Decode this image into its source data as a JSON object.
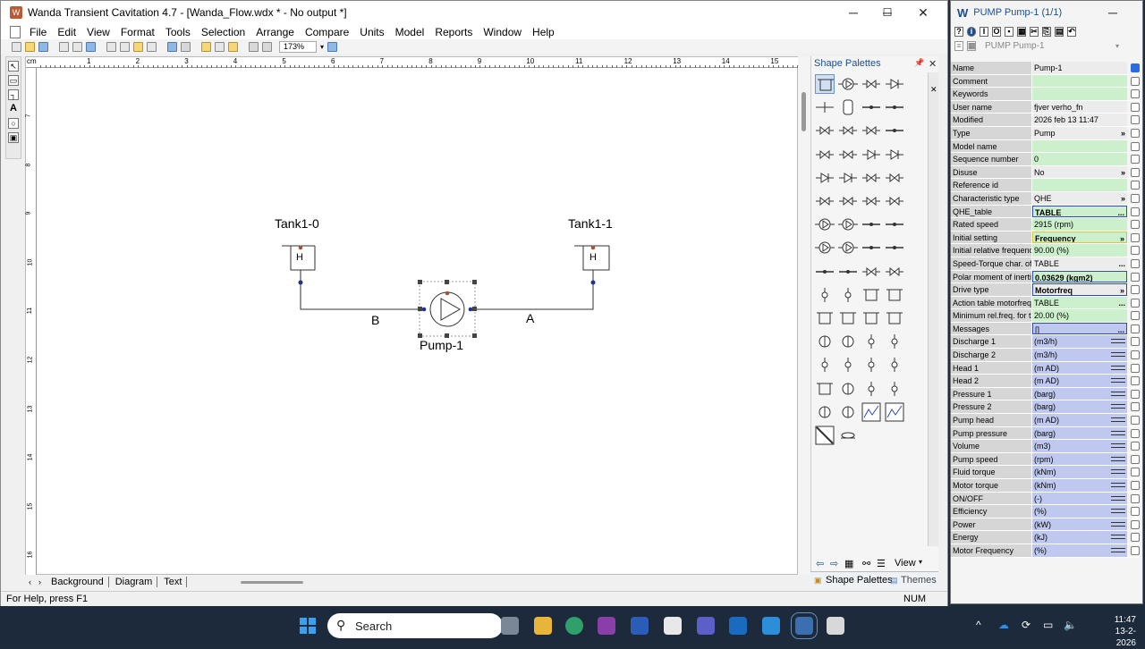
{
  "window": {
    "title": "Wanda Transient Cavitation 4.7 - [Wanda_Flow.wdx * - No output *]",
    "min": "─",
    "max": "☐",
    "close": "✕"
  },
  "menu": [
    "File",
    "Edit",
    "View",
    "Format",
    "Tools",
    "Selection",
    "Arrange",
    "Compare",
    "Units",
    "Model",
    "Reports",
    "Window",
    "Help"
  ],
  "toolbar": {
    "zoom": "173%"
  },
  "ruler": {
    "unit": "cm",
    "h_ticks": [
      "1",
      "2",
      "3",
      "4",
      "5",
      "6",
      "7",
      "8",
      "9",
      "10",
      "11",
      "12",
      "13",
      "14",
      "15"
    ],
    "v_ticks": [
      "7",
      "8",
      "9",
      "10",
      "11",
      "12",
      "13",
      "14",
      "15",
      "16"
    ]
  },
  "diagram": {
    "tank_left": "Tank1-0",
    "tank_right": "Tank1-1",
    "tank_symbol": "H",
    "pump": "Pump-1",
    "pipe_left": "B",
    "pipe_right": "A"
  },
  "tabs": [
    "Background",
    "Diagram",
    "Text"
  ],
  "status": {
    "help": "For Help, press F1",
    "num": "NUM"
  },
  "palette": {
    "title": "Shape Palettes",
    "view": "View",
    "tab_shapes": "Shape Palettes",
    "tab_themes": "Themes"
  },
  "props": {
    "title": "PUMP Pump-1 (1/1)",
    "object": "PUMP Pump-1",
    "rows": [
      {
        "name": "Name",
        "value": "Pump-1",
        "style": "w",
        "check": true
      },
      {
        "name": "Comment",
        "value": "",
        "style": "g"
      },
      {
        "name": "Keywords",
        "value": "",
        "style": "g"
      },
      {
        "name": "User name",
        "value": "fjver verho_fn",
        "style": "w"
      },
      {
        "name": "Modified",
        "value": "2026 feb 13  11:47",
        "style": "w"
      },
      {
        "name": "Type",
        "value": "Pump",
        "style": "w",
        "btn": "»"
      },
      {
        "name": "Model name",
        "value": "",
        "style": "g"
      },
      {
        "name": "Sequence number",
        "value": "0",
        "style": "g"
      },
      {
        "name": "Disuse",
        "value": "No",
        "style": "w",
        "btn": "»"
      },
      {
        "name": "Reference id",
        "value": "",
        "style": "g"
      },
      {
        "name": "Characteristic type",
        "value": "QHE",
        "style": "w",
        "btn": "»"
      },
      {
        "name": "QHE_table",
        "value": "TABLE",
        "style": "g",
        "bold": true,
        "sel": true,
        "btn": "..."
      },
      {
        "name": "Rated speed",
        "value": "2915 (rpm)",
        "style": "g"
      },
      {
        "name": "Initial setting",
        "value": "Frequency",
        "style": "g",
        "bold": true,
        "yel": true,
        "btn": "»"
      },
      {
        "name": "Initial relative frequency",
        "value": "90.00 (%)",
        "style": "g"
      },
      {
        "name": "Speed-Torque char. of motor",
        "value": "TABLE",
        "style": "w",
        "btn": "..."
      },
      {
        "name": "Polar moment of inertia",
        "value": "0.03629 (kgm2)",
        "style": "g",
        "bold": true,
        "sel": true
      },
      {
        "name": "Drive type",
        "value": "Motorfreq",
        "style": "w",
        "bold": true,
        "sel": true,
        "btn": "»"
      },
      {
        "name": "Action table motorfreq.",
        "value": "TABLE",
        "style": "g",
        "btn": "..."
      },
      {
        "name": "Minimum rel.freq. for trip",
        "value": "20.00 (%)",
        "style": "g"
      },
      {
        "name": "Messages",
        "value": "[]",
        "style": "b",
        "sel": true,
        "btn": "..."
      },
      {
        "name": "Discharge 1",
        "value": "(m3/h)",
        "style": "b",
        "wave": true
      },
      {
        "name": "Discharge 2",
        "value": "(m3/h)",
        "style": "b",
        "wave": true
      },
      {
        "name": "Head 1",
        "value": "(m AD)",
        "style": "b",
        "wave": true
      },
      {
        "name": "Head 2",
        "value": "(m AD)",
        "style": "b",
        "wave": true
      },
      {
        "name": "Pressure 1",
        "value": "(barg)",
        "style": "b",
        "wave": true
      },
      {
        "name": "Pressure 2",
        "value": "(barg)",
        "style": "b",
        "wave": true
      },
      {
        "name": "Pump head",
        "value": "(m AD)",
        "style": "b",
        "wave": true
      },
      {
        "name": "Pump pressure",
        "value": "(barg)",
        "style": "b",
        "wave": true
      },
      {
        "name": "Volume",
        "value": "(m3)",
        "style": "b",
        "wave": true
      },
      {
        "name": "Pump speed",
        "value": "(rpm)",
        "style": "b",
        "wave": true
      },
      {
        "name": "Fluid torque",
        "value": "(kNm)",
        "style": "b",
        "wave": true
      },
      {
        "name": "Motor torque",
        "value": "(kNm)",
        "style": "b",
        "wave": true
      },
      {
        "name": "ON/OFF",
        "value": "(-)",
        "style": "b",
        "wave": true
      },
      {
        "name": "Efficiency",
        "value": "(%)",
        "style": "b",
        "wave": true
      },
      {
        "name": "Power",
        "value": "(kW)",
        "style": "b",
        "wave": true
      },
      {
        "name": "Energy",
        "value": "(kJ)",
        "style": "b",
        "wave": true
      },
      {
        "name": "Motor Frequency",
        "value": "(%)",
        "style": "b",
        "wave": true
      }
    ]
  },
  "taskbar": {
    "search": "Search",
    "time": "11:47",
    "date": "13-2-2026"
  },
  "colors": {
    "accent": "#2c4bb8",
    "field_green": "#ccf0cc",
    "field_blue": "#bfc9ef",
    "taskbar": "#1c2a3c"
  }
}
